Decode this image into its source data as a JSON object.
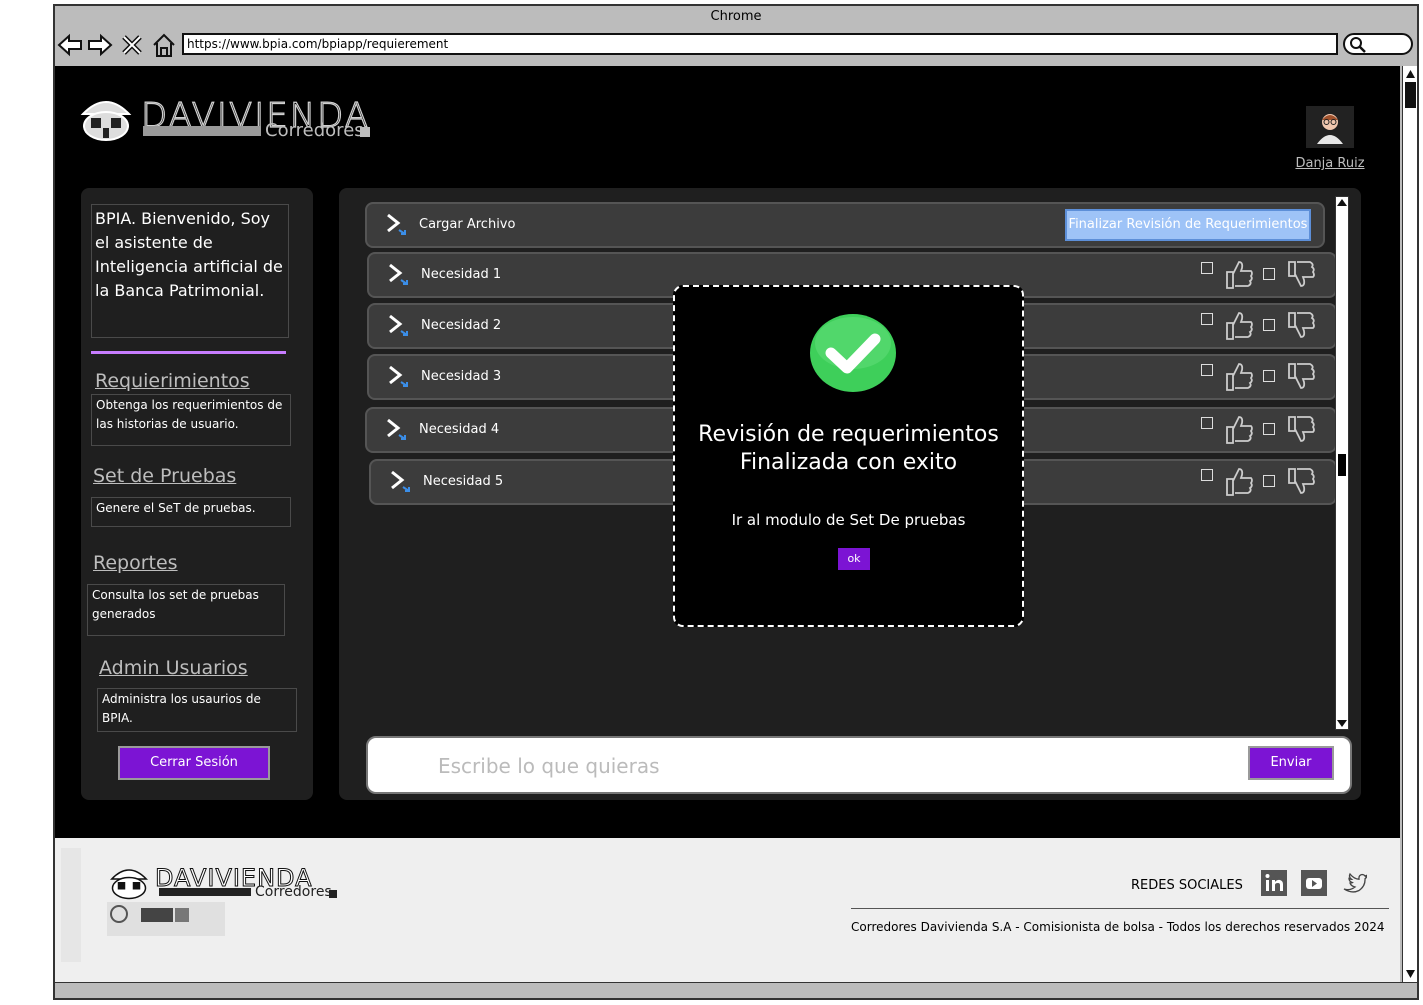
{
  "browser": {
    "title": "Chrome",
    "url": "https://www.bpia.com/bpiapp/requierement"
  },
  "header": {
    "logo_word": "DAVIVIENDA",
    "logo_sub": "Corredores",
    "user_name": "Danja Ruiz"
  },
  "sidebar": {
    "intro": "BPIA. Bienvenido, Soy el asistente de Inteligencia artificial de la Banca Patrimonial.",
    "items": [
      {
        "label": "Requierimientos",
        "desc": "Obtenga los requerimientos de las historias de usuario."
      },
      {
        "label": "Set de Pruebas",
        "desc": "Genere el SeT de pruebas."
      },
      {
        "label": "Reportes",
        "desc": "Consulta los set de pruebas generados"
      },
      {
        "label": "Admin Usuarios",
        "desc": "Administra los usaurios de BPIA."
      }
    ],
    "logout_label": "Cerrar Sesión"
  },
  "main": {
    "upload_label": "Cargar Archivo",
    "finalize_label": "Finalizar Revisión de Requerimientos",
    "needs": [
      {
        "label": "Necesidad 1"
      },
      {
        "label": "Necesidad 2"
      },
      {
        "label": "Necesidad 3"
      },
      {
        "label": "Necesidad 4"
      },
      {
        "label": "Necesidad 5"
      }
    ],
    "chat_placeholder": "Escribe lo que quieras",
    "send_label": "Enviar"
  },
  "modal": {
    "title_line1": "Revisión de requerimientos",
    "title_line2": "Finalizada con exito",
    "subtitle": "Ir al modulo de Set De pruebas",
    "ok_label": "ok",
    "success_color": "#3ecf5a"
  },
  "footer": {
    "logo_word": "DAVIVIENDA",
    "logo_sub": "Corredores",
    "social_label": "REDES SOCIALES",
    "social_icons": [
      "linkedin-icon",
      "youtube-icon",
      "twitter-icon"
    ],
    "copyright": "Corredores Davivienda S.A - Comisionista de bolsa - Todos los derechos reservados 2024"
  },
  "colors": {
    "accent_purple": "#7c14d4",
    "finalize_blue": "#9ec3f7",
    "background": "#000000"
  }
}
